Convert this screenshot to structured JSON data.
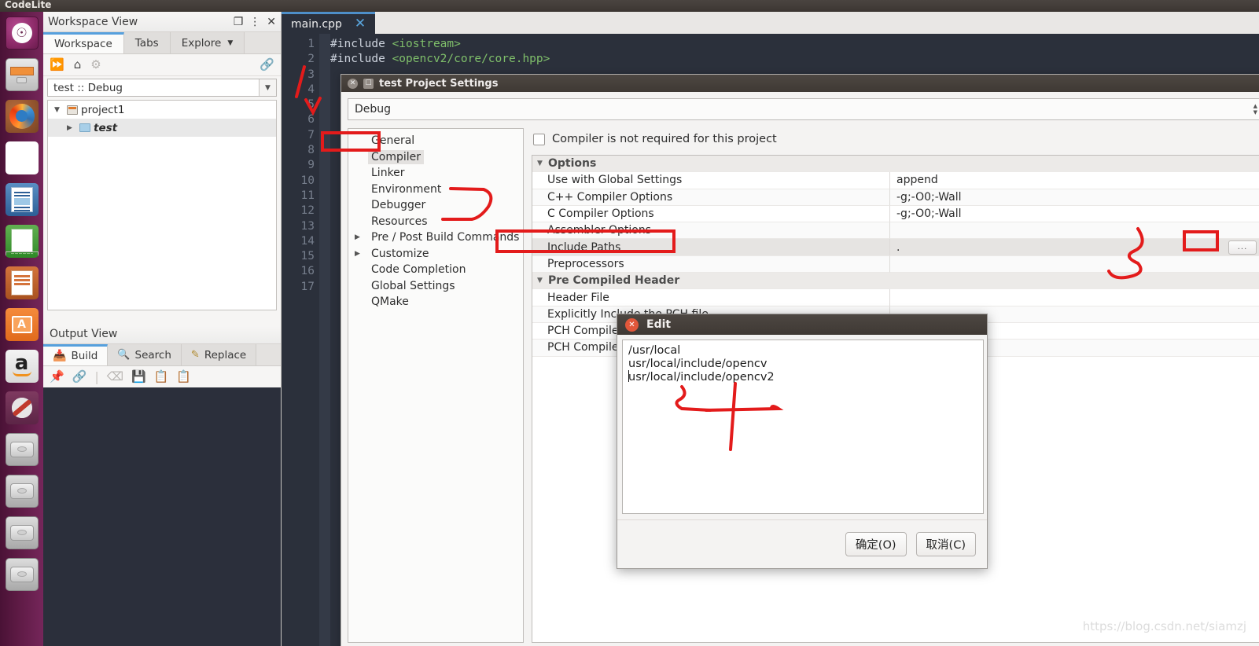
{
  "desktop": {
    "window_title": "CodeLite",
    "launcher_items": [
      {
        "name": "ubuntu-dash-icon",
        "label": "Ubuntu"
      },
      {
        "name": "files-icon",
        "label": "Files"
      },
      {
        "name": "firefox-icon",
        "label": "Firefox"
      },
      {
        "name": "quad-colors-icon",
        "label": "Quad"
      },
      {
        "name": "libreoffice-writer-icon",
        "label": "LibreOffice Writer"
      },
      {
        "name": "libreoffice-calc-icon",
        "label": "LibreOffice Calc"
      },
      {
        "name": "libreoffice-impress-icon",
        "label": "LibreOffice Impress"
      },
      {
        "name": "ubuntu-software-icon",
        "label": "Ubuntu Software"
      },
      {
        "name": "amazon-icon",
        "label": "Amazon"
      },
      {
        "name": "system-settings-icon",
        "label": "System Settings"
      },
      {
        "name": "disk-icon-1",
        "label": "Disk"
      },
      {
        "name": "disk-icon-2",
        "label": "Disk"
      },
      {
        "name": "disk-icon-3",
        "label": "Disk"
      },
      {
        "name": "disk-icon-4",
        "label": "Disk"
      }
    ],
    "watermark": "https://blog.csdn.net/siamzj"
  },
  "workspace_view": {
    "title": "Workspace View",
    "header_icons": [
      "restore-icon",
      "menu-dots-icon",
      "close-icon"
    ],
    "tabs": [
      {
        "label": "Workspace",
        "active": true
      },
      {
        "label": "Tabs",
        "active": false
      },
      {
        "label": "Explore",
        "active": false,
        "has_dropdown": true
      }
    ],
    "toolbar_icons": [
      "send-icon",
      "home-icon",
      "gear-icon",
      "link-icon"
    ],
    "config_select": "test :: Debug",
    "tree": [
      {
        "label": "project1",
        "expander": "▼",
        "icon": "project-icon",
        "indent": 0,
        "italic": false,
        "bold": false
      },
      {
        "label": "test",
        "expander": "▶",
        "icon": "folder-icon",
        "indent": 1,
        "italic": true,
        "bold": true
      }
    ]
  },
  "output_view": {
    "title": "Output View",
    "tabs": [
      {
        "label": "Build",
        "icon": "build-icon",
        "active": true
      },
      {
        "label": "Search",
        "icon": "search-icon",
        "active": false
      },
      {
        "label": "Replace",
        "icon": "pencil-icon",
        "active": false
      }
    ],
    "toolbar_icons": [
      "pin-icon",
      "link-icon",
      "clear-icon",
      "save-icon",
      "copy-icon",
      "paste-icon"
    ]
  },
  "editor": {
    "tab": {
      "label": "main.cpp",
      "close": "✕"
    },
    "line_numbers": [
      1,
      2,
      3,
      4,
      5,
      6,
      7,
      8,
      9,
      10,
      11,
      12,
      13,
      14,
      15,
      16,
      17
    ],
    "code_lines": [
      {
        "keyword": "#include ",
        "value": "<iostream>"
      },
      {
        "keyword": "#include ",
        "value": "<opencv2/core/core.hpp>"
      }
    ]
  },
  "project_settings": {
    "title": "test Project Settings",
    "window_buttons": [
      "close-icon",
      "maximize-icon"
    ],
    "configuration": "Debug",
    "categories": [
      {
        "label": "General",
        "expander": "",
        "selected": false
      },
      {
        "label": "Compiler",
        "expander": "",
        "selected": true
      },
      {
        "label": "Linker",
        "expander": "",
        "selected": false
      },
      {
        "label": "Environment",
        "expander": "",
        "selected": false
      },
      {
        "label": "Debugger",
        "expander": "",
        "selected": false
      },
      {
        "label": "Resources",
        "expander": "",
        "selected": false
      },
      {
        "label": "Pre / Post Build Commands",
        "expander": "▶",
        "selected": false
      },
      {
        "label": "Customize",
        "expander": "▶",
        "selected": false
      },
      {
        "label": "Code Completion",
        "expander": "",
        "selected": false
      },
      {
        "label": "Global Settings",
        "expander": "",
        "selected": false
      },
      {
        "label": "QMake",
        "expander": "",
        "selected": false
      }
    ],
    "checkbox": {
      "label": "Compiler is not required for this project",
      "checked": false
    },
    "grid_rows": [
      {
        "type": "category",
        "name": "Options",
        "value": "",
        "expander": "▼"
      },
      {
        "type": "row",
        "name": "Use with Global Settings",
        "value": "append"
      },
      {
        "type": "row",
        "name": "C++ Compiler Options",
        "value": "-g;-O0;-Wall"
      },
      {
        "type": "row",
        "name": "C Compiler Options",
        "value": "-g;-O0;-Wall"
      },
      {
        "type": "row",
        "name": "Assembler Options",
        "value": ""
      },
      {
        "type": "row",
        "name": "Include Paths",
        "value": ".",
        "selected": true,
        "has_browse": true,
        "browse_label": "..."
      },
      {
        "type": "row",
        "name": "Preprocessors",
        "value": ""
      },
      {
        "type": "category",
        "name": "Pre Compiled Header",
        "value": "",
        "expander": "▼"
      },
      {
        "type": "row",
        "name": "Header File",
        "value": ""
      },
      {
        "type": "row",
        "name": "Explicitly Include the PCH file",
        "value": ""
      },
      {
        "type": "row",
        "name": "PCH Compile Flags",
        "value": ""
      },
      {
        "type": "row",
        "name": "PCH Compiler Flags Policy",
        "value": ""
      }
    ]
  },
  "edit_dialog": {
    "title": "Edit",
    "close_icon": "close-icon",
    "text_lines": [
      "/usr/local",
      "usr/local/include/opencv",
      "usr/local/include/opencv2"
    ],
    "buttons": [
      {
        "label": "确定(O)",
        "name": "ok-button"
      },
      {
        "label": "取消(C)",
        "name": "cancel-button"
      }
    ]
  },
  "colors": {
    "annotation_red": "#e31b1b",
    "accent_blue": "#56a0dd",
    "editor_bg": "#2b303b"
  }
}
